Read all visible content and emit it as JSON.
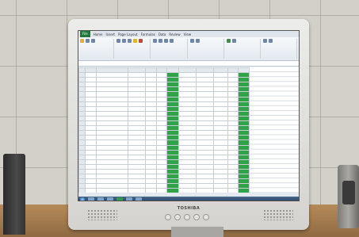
{
  "monitor": {
    "brand": "TOSHIBA"
  },
  "excel": {
    "ribbon_tabs": [
      "File",
      "Home",
      "Insert",
      "Page Layout",
      "Formulas",
      "Data",
      "Review",
      "View"
    ],
    "row_count": 28
  },
  "colors": {
    "highlight_column": "#2fa446",
    "file_tab": "#1f7a3a",
    "taskbar": "#243d5c"
  }
}
